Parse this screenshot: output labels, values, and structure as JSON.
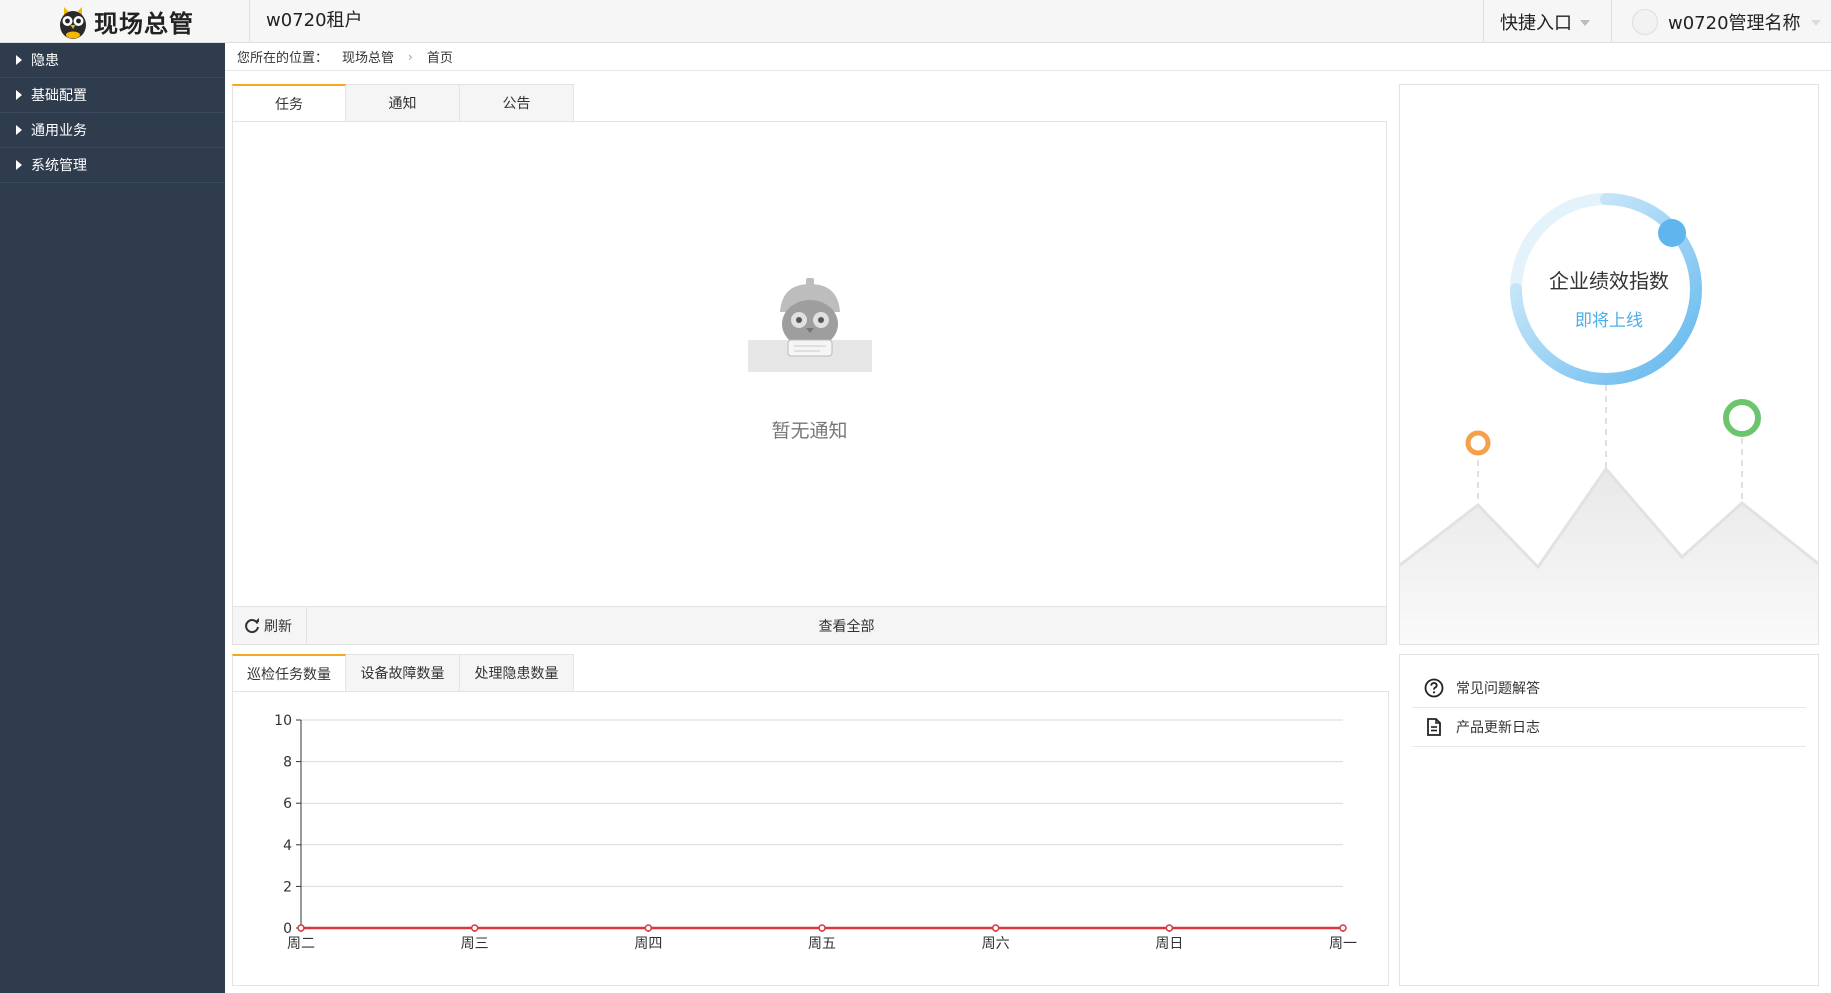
{
  "header": {
    "logo_text": "现场总管",
    "tenant": "w0720租户",
    "quick_entry": "快捷入口",
    "user_name": "w0720管理名称"
  },
  "sidebar": {
    "items": [
      {
        "label": "隐患"
      },
      {
        "label": "基础配置"
      },
      {
        "label": "通用业务"
      },
      {
        "label": "系统管理"
      }
    ]
  },
  "breadcrumb": {
    "prefix": "您所在的位置：",
    "items": [
      "现场总管",
      "首页"
    ]
  },
  "notice_panel": {
    "tabs": [
      "任务",
      "通知",
      "公告"
    ],
    "active_tab": 0,
    "empty_text": "暂无通知",
    "refresh_label": "刷新",
    "view_all_label": "查看全部"
  },
  "performance": {
    "title": "企业绩效指数",
    "subtitle": "即将上线"
  },
  "chart_panel": {
    "tabs": [
      "巡检任务数量",
      "设备故障数量",
      "处理隐患数量"
    ],
    "active_tab": 0
  },
  "help": {
    "items": [
      {
        "label": "常见问题解答",
        "icon": "question-circle-icon"
      },
      {
        "label": "产品更新日志",
        "icon": "document-icon"
      }
    ]
  },
  "colors": {
    "accent": "#f5a623",
    "sidebar_bg": "#2f3c4e",
    "series_line": "#d9363e",
    "link_blue": "#4aaee8"
  },
  "chart_data": {
    "type": "line",
    "categories": [
      "周二",
      "周三",
      "周四",
      "周五",
      "周六",
      "周日",
      "周一"
    ],
    "series": [
      {
        "values": [
          0,
          0,
          0,
          0,
          0,
          0,
          0
        ]
      }
    ],
    "yticks": [
      "0",
      "2",
      "4",
      "6",
      "8",
      "10"
    ],
    "ylim": [
      0,
      10
    ],
    "grid": true,
    "legend": "none"
  }
}
